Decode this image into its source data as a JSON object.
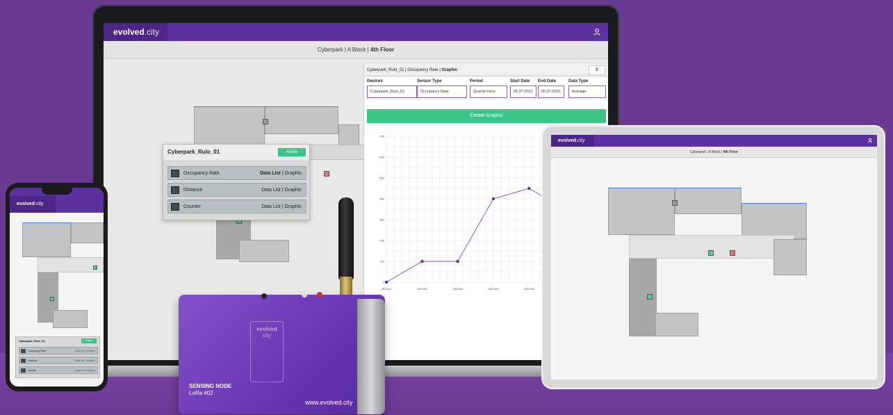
{
  "brand": {
    "name": "evolved",
    "suffix": ".city"
  },
  "laptop": {
    "breadcrumb": {
      "prefix": "Cyberpark | A Block | ",
      "floor": "4th Floor"
    },
    "device_popup": {
      "device_name": "Cyberpark_Rulo_01",
      "status": "Active",
      "rows": [
        {
          "label": "Occupancy Rate",
          "data_list": "Data List",
          "separator": "|",
          "graphic": "Graphic",
          "icon": "chart-icon"
        },
        {
          "label": "Distance",
          "data_list": "Data List",
          "separator": "|",
          "graphic": "Graphic",
          "icon": "ruler-icon"
        },
        {
          "label": "Counter",
          "data_list": "Data List",
          "separator": "|",
          "graphic": "Graphic",
          "icon": "counter-icon"
        }
      ]
    },
    "graphic_panel": {
      "title_prefix": "Cyberpark_Rulo_01 | Occupancy Rate | ",
      "title_bold": "Graphic",
      "close_label": "X",
      "fields": {
        "devices": {
          "label": "Devices",
          "value": "Cyberpark_Rulo_01"
        },
        "sensor_type": {
          "label": "Sensor Type",
          "value": "Occupancy Rate"
        },
        "period": {
          "label": "Period",
          "value": "Quarter Hour"
        },
        "start_date": {
          "label": "Start Date",
          "value": "05.07.2021"
        },
        "end_date": {
          "label": "End Date",
          "value": "05.07.2021"
        },
        "data_type": {
          "label": "Data Type",
          "value": "Average"
        }
      },
      "create_button": "Create Graphic"
    }
  },
  "chart_data": {
    "type": "line",
    "x": [
      "2021/01",
      "2021/02",
      "2021/03",
      "2021/04",
      "2021/05",
      "2021/06",
      "2021/07"
    ],
    "values": [
      0,
      100,
      100,
      400,
      450,
      350,
      550
    ],
    "y_ticks": [
      "0",
      "100",
      "200",
      "300",
      "400",
      "500",
      "600",
      "700"
    ],
    "x_tick_labels": [
      "2021/01",
      "2021/02",
      "2021/03",
      "2021/04",
      "2021/05"
    ],
    "ylim": [
      0,
      700
    ],
    "grid": true,
    "color": "#9a6fd4"
  },
  "tablet": {
    "breadcrumb": {
      "prefix": "Cyberpark | A Block | ",
      "floor": "4th Floor"
    }
  },
  "phone": {
    "device_popup": {
      "device_name": "Cyberpark_Rulo_01",
      "status": "Active",
      "rows": [
        {
          "label": "Occupancy Rate",
          "actions": "Data List  |  Graphic"
        },
        {
          "label": "Distance",
          "actions": "Data List  |  Graphic"
        },
        {
          "label": "Counter",
          "actions": "Data List  |  Graphic"
        }
      ]
    }
  },
  "sensor_node": {
    "title_line1": "SENSING NODE",
    "title_line2": "LoRa #02",
    "logo_name": "evolved",
    "logo_suffix": "city",
    "url": "www.evolved.city"
  },
  "colors": {
    "background": "#6a3a93",
    "brand_purple": "#5b31a0",
    "accent_green": "#3dc489",
    "marker_red": "#e07a7a"
  }
}
